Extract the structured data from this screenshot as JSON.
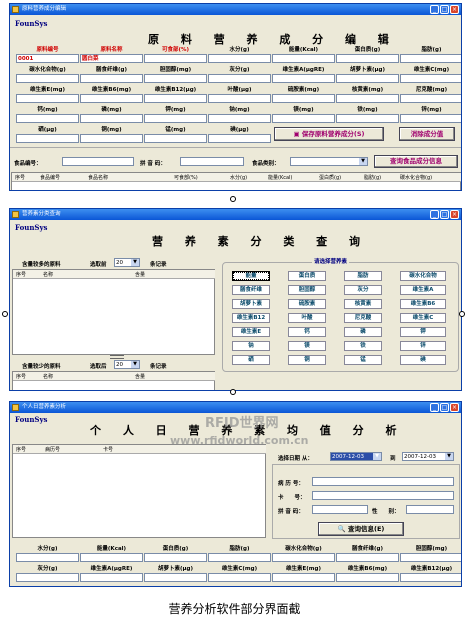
{
  "w1": {
    "title": "原料营养成分编辑",
    "brand": "FounSys",
    "heading": "原 料 营 养 成 分 编 辑",
    "fields": [
      {
        "label": "原料编号",
        "value": "0001"
      },
      {
        "label": "原料名称",
        "value": "圆白菜"
      },
      {
        "label": "可食部(%)",
        "value": ""
      },
      {
        "label": "水分(g)",
        "value": ""
      },
      {
        "label": "能量(Kcal)",
        "value": ""
      },
      {
        "label": "蛋白质(g)",
        "value": ""
      },
      {
        "label": "脂肪(g)",
        "value": ""
      },
      {
        "label": "碳水化合物(g)",
        "value": ""
      },
      {
        "label": "膳食纤维(g)",
        "value": ""
      },
      {
        "label": "胆固醇(mg)",
        "value": ""
      },
      {
        "label": "灰分(g)",
        "value": ""
      },
      {
        "label": "维生素A(μgRE)",
        "value": ""
      },
      {
        "label": "胡萝卜素(μg)",
        "value": ""
      },
      {
        "label": "维生素C(mg)",
        "value": ""
      },
      {
        "label": "维生素E(mg)",
        "value": ""
      },
      {
        "label": "维生素B6(mg)",
        "value": ""
      },
      {
        "label": "维生素B12(μg)",
        "value": ""
      },
      {
        "label": "叶酸(μg)",
        "value": ""
      },
      {
        "label": "硫胺素(mg)",
        "value": ""
      },
      {
        "label": "核黄素(mg)",
        "value": ""
      },
      {
        "label": "尼克酸(mg)",
        "value": ""
      },
      {
        "label": "钙(mg)",
        "value": ""
      },
      {
        "label": "磷(mg)",
        "value": ""
      },
      {
        "label": "钾(mg)",
        "value": ""
      },
      {
        "label": "钠(mg)",
        "value": ""
      },
      {
        "label": "镁(mg)",
        "value": ""
      },
      {
        "label": "铁(mg)",
        "value": ""
      },
      {
        "label": "锌(mg)",
        "value": ""
      },
      {
        "label": "硒(μg)",
        "value": ""
      },
      {
        "label": "铜(mg)",
        "value": ""
      },
      {
        "label": "锰(mg)",
        "value": ""
      },
      {
        "label": "碘(μg)",
        "value": ""
      }
    ],
    "save_button": "保存原料营养成分(S)",
    "clear_button": "消除成分值",
    "food_code_label": "食品编号：",
    "pinyin_label": "拼 音 码：",
    "category_label": "食品类别：",
    "query_button": "查询食品成分信息",
    "columns": [
      "序号",
      "食品编号",
      "食品名称",
      "可食部(%)",
      "水分(g)",
      "能量(Kcal)",
      "蛋白质(g)",
      "脂肪(g)",
      "碳水化合物(g)"
    ]
  },
  "w2": {
    "title": "营养素分类查询",
    "brand": "FounSys",
    "heading": "营 养 素 分 类 查 询",
    "more_label": "含量较多的原料",
    "take_front_label": "选取前",
    "take_front_value": "20",
    "records_label": "条记录",
    "less_label": "含量较少的原料",
    "take_back_label": "选取后",
    "take_back_value": "20",
    "records_label2": "条记录",
    "columns": [
      "序号",
      "名称",
      "含量"
    ],
    "select_prompt": "请选择营养素",
    "nutrients": [
      "能量",
      "蛋白质",
      "脂肪",
      "碳水化合物",
      "膳食纤维",
      "胆固醇",
      "灰分",
      "维生素A",
      "胡萝卜素",
      "硫胺素",
      "核黄素",
      "维生素B6",
      "维生素B12",
      "叶酸",
      "尼克酸",
      "维生素C",
      "维生素E",
      "钙",
      "磷",
      "钾",
      "钠",
      "镁",
      "铁",
      "锌",
      "硒",
      "铜",
      "锰",
      "碘"
    ]
  },
  "w3": {
    "title": "个人日营养素分析",
    "brand": "FounSys",
    "heading": "个 人 日 营 养 素 均 值 分 析",
    "columns": [
      "序号",
      "病历号",
      "卡号"
    ],
    "date_label": "选择日期 从：",
    "date_from": "2007-12-03",
    "to_label": "到",
    "date_to": "2007-12-03",
    "record_label": "病 历 号：",
    "card_label": "卡　　号：",
    "pinyin_label": "拼 音 码：",
    "gender_label": "性　　别：",
    "query_button": "查询信息(E)",
    "row1": [
      "水分(g)",
      "能量(Kcal)",
      "蛋白质(g)",
      "脂肪(g)",
      "碳水化合物(g)",
      "膳食纤维(g)",
      "胆固醇(mg)"
    ],
    "row2": [
      "灰分(g)",
      "维生素A(μgRE)",
      "胡萝卜素(μg)",
      "维生素C(mg)",
      "维生素E(mg)",
      "维生素B6(mg)",
      "维生素B12(μg)"
    ]
  },
  "watermark": {
    "line1": "RFID世界网",
    "line2": "www.rfidworld.com.cn"
  },
  "caption": "营养分析软件部分界面截"
}
